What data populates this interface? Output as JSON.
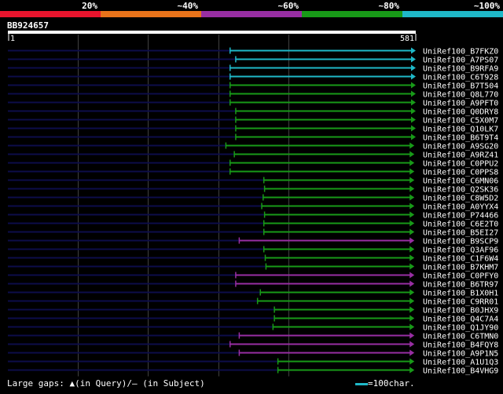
{
  "chart_data": {
    "type": "alignment",
    "identity_scale": {
      "labels": [
        "20%",
        "~40%",
        "~60%",
        "~80%",
        "~100%"
      ],
      "colors": [
        "#e8142d",
        "#e8731a",
        "#982ea3",
        "#189a18",
        "#1fb8c8"
      ]
    },
    "query": {
      "name": "BB924657",
      "start": 1,
      "end": 581
    },
    "grid_positions": [
      100,
      200,
      300,
      400
    ],
    "hits": [
      {
        "name": "UniRef100_B7FKZ0",
        "start": 317,
        "end": 581,
        "identity": "~100%"
      },
      {
        "name": "UniRef100_A7PS07",
        "start": 325,
        "end": 581,
        "identity": "~100%"
      },
      {
        "name": "UniRef100_B9RFA9",
        "start": 317,
        "end": 581,
        "identity": "~100%"
      },
      {
        "name": "UniRef100_C6T928",
        "start": 317,
        "end": 581,
        "identity": "~100%"
      },
      {
        "name": "UniRef100_B7T504",
        "start": 317,
        "end": 581,
        "identity": "~80%"
      },
      {
        "name": "UniRef100_Q8L770",
        "start": 317,
        "end": 581,
        "identity": "~80%"
      },
      {
        "name": "UniRef100_A9PFT0",
        "start": 317,
        "end": 581,
        "identity": "~80%"
      },
      {
        "name": "UniRef100_Q0DRY8",
        "start": 325,
        "end": 581,
        "identity": "~80%"
      },
      {
        "name": "UniRef100_C5X0M7",
        "start": 325,
        "end": 581,
        "identity": "~80%"
      },
      {
        "name": "UniRef100_Q10LK7",
        "start": 325,
        "end": 581,
        "identity": "~80%"
      },
      {
        "name": "UniRef100_B6T9T4",
        "start": 325,
        "end": 581,
        "identity": "~80%"
      },
      {
        "name": "UniRef100_A9SG20",
        "start": 311,
        "end": 579,
        "identity": "~80%"
      },
      {
        "name": "UniRef100_A9RZ41",
        "start": 323,
        "end": 579,
        "identity": "~80%"
      },
      {
        "name": "UniRef100_C0PPU2",
        "start": 317,
        "end": 579,
        "identity": "~80%"
      },
      {
        "name": "UniRef100_C0PPS8",
        "start": 317,
        "end": 579,
        "identity": "~80%"
      },
      {
        "name": "UniRef100_C6MN06",
        "start": 365,
        "end": 579,
        "identity": "~80%"
      },
      {
        "name": "UniRef100_Q2SK36",
        "start": 366,
        "end": 579,
        "identity": "~80%"
      },
      {
        "name": "UniRef100_C8W5D2",
        "start": 364,
        "end": 579,
        "identity": "~80%"
      },
      {
        "name": "UniRef100_A0YYX4",
        "start": 362,
        "end": 579,
        "identity": "~80%"
      },
      {
        "name": "UniRef100_P74466",
        "start": 366,
        "end": 579,
        "identity": "~80%"
      },
      {
        "name": "UniRef100_C6E2T0",
        "start": 365,
        "end": 579,
        "identity": "~80%"
      },
      {
        "name": "UniRef100_B5EI27",
        "start": 365,
        "end": 579,
        "identity": "~80%"
      },
      {
        "name": "UniRef100_B9SCP9",
        "start": 330,
        "end": 579,
        "identity": "~60%"
      },
      {
        "name": "UniRef100_Q3AF96",
        "start": 365,
        "end": 579,
        "identity": "~80%"
      },
      {
        "name": "UniRef100_C1F6W4",
        "start": 367,
        "end": 579,
        "identity": "~80%"
      },
      {
        "name": "UniRef100_B7KHM7",
        "start": 368,
        "end": 579,
        "identity": "~80%"
      },
      {
        "name": "UniRef100_C0PFY0",
        "start": 325,
        "end": 579,
        "identity": "~60%"
      },
      {
        "name": "UniRef100_B6TR97",
        "start": 325,
        "end": 579,
        "identity": "~60%"
      },
      {
        "name": "UniRef100_B1X0H1",
        "start": 360,
        "end": 579,
        "identity": "~80%"
      },
      {
        "name": "UniRef100_C9RR01",
        "start": 356,
        "end": 579,
        "identity": "~80%"
      },
      {
        "name": "UniRef100_B0JHX9",
        "start": 380,
        "end": 579,
        "identity": "~80%"
      },
      {
        "name": "UniRef100_Q4C7A4",
        "start": 380,
        "end": 579,
        "identity": "~80%"
      },
      {
        "name": "UniRef100_Q1JY90",
        "start": 378,
        "end": 579,
        "identity": "~80%"
      },
      {
        "name": "UniRef100_C6TMN0",
        "start": 330,
        "end": 579,
        "identity": "~60%"
      },
      {
        "name": "UniRef100_B4FQY8",
        "start": 317,
        "end": 579,
        "identity": "~60%"
      },
      {
        "name": "UniRef100_A9P1N5",
        "start": 330,
        "end": 579,
        "identity": "~60%"
      },
      {
        "name": "UniRef100_A1U1Q3",
        "start": 385,
        "end": 579,
        "identity": "~80%"
      },
      {
        "name": "UniRef100_B4VHG9",
        "start": 385,
        "end": 579,
        "identity": "~80%"
      }
    ]
  },
  "footer": {
    "gaps_label": "Large gaps:",
    "gaps_query_symbol": "▲",
    "gaps_query_text": "(in Query)/",
    "gaps_subject_symbol": "—",
    "gaps_subject_text": "(in Subject)",
    "scale_text": "=100char."
  },
  "colors": {
    "background": "#000000",
    "text": "#ffffff",
    "grid": "#404040",
    "left_track": "#0d0d4a",
    "query_bar": "#ffffff",
    "scale_swatch": "#1fb8c8"
  }
}
